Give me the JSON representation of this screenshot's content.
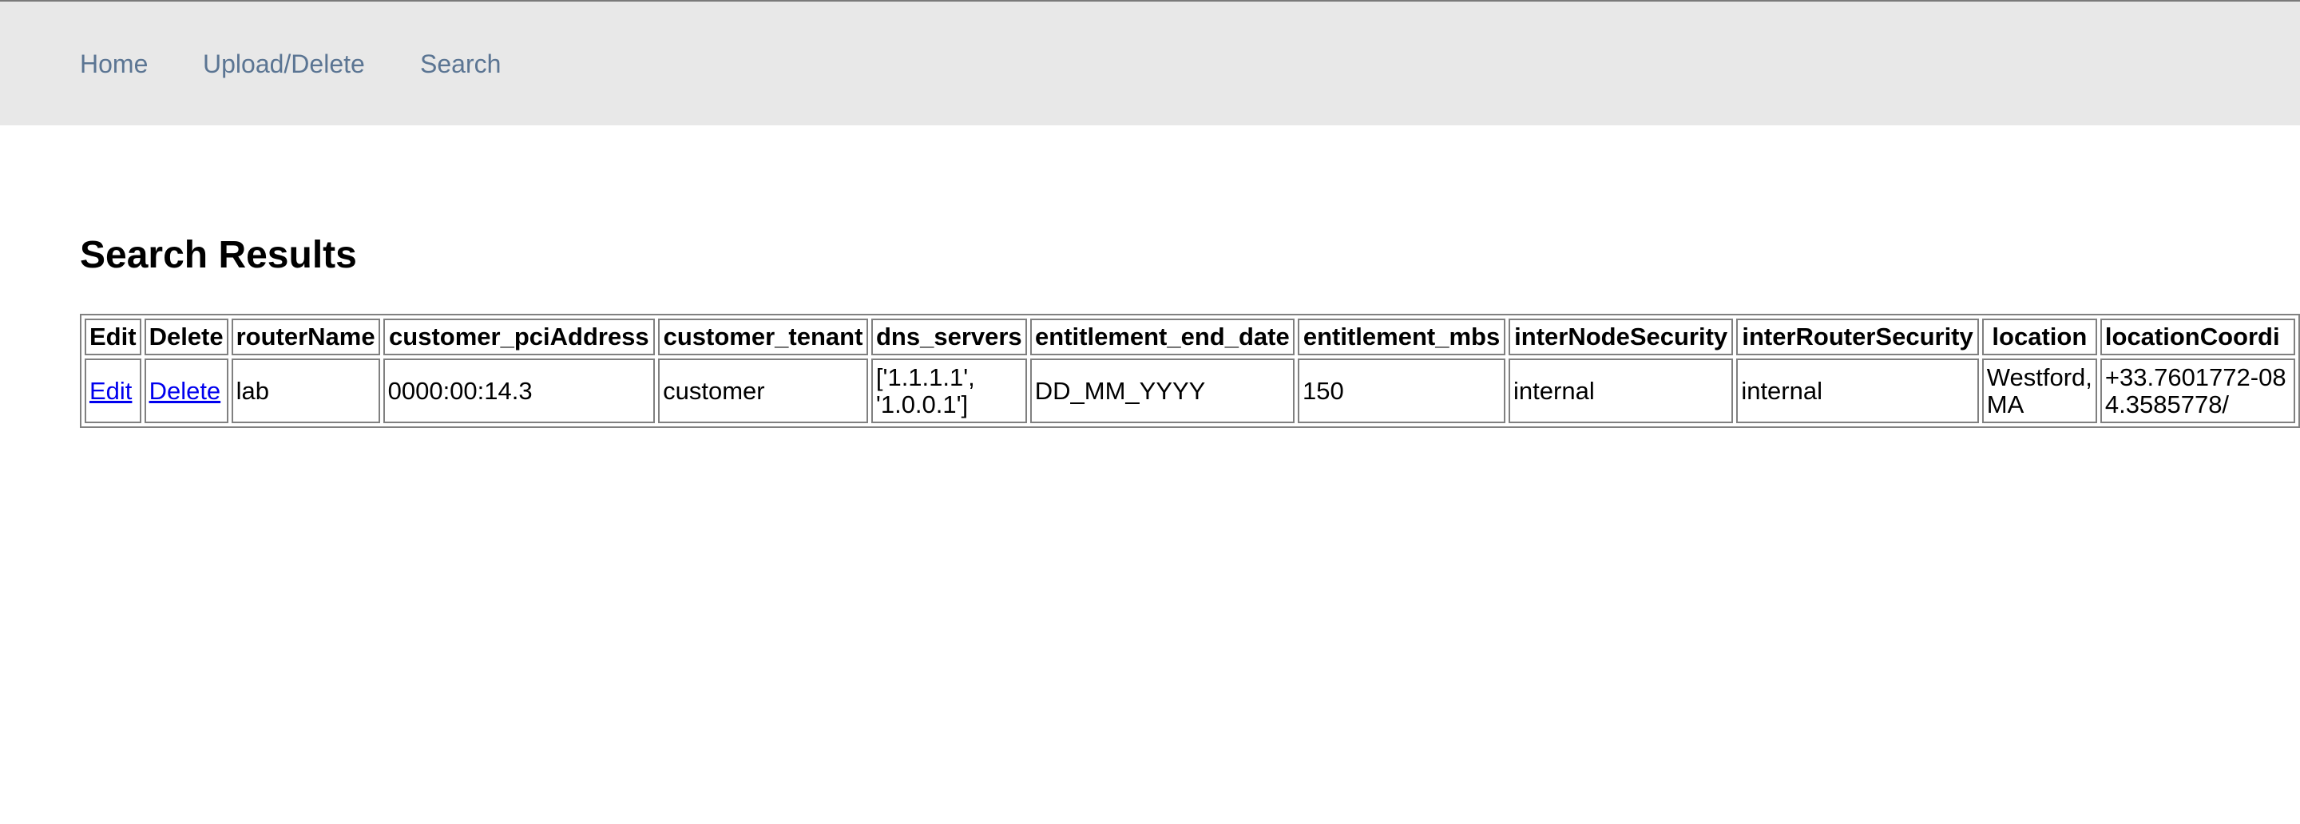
{
  "nav": {
    "home": "Home",
    "upload_delete": "Upload/Delete",
    "search": "Search"
  },
  "page": {
    "title": "Search Results"
  },
  "table": {
    "headers": [
      "Edit",
      "Delete",
      "routerName",
      "customer_pciAddress",
      "customer_tenant",
      "dns_servers",
      "entitlement_end_date",
      "entitlement_mbs",
      "interNodeSecurity",
      "interRouterSecurity",
      "location",
      "locationCoordi"
    ],
    "rows": [
      {
        "edit_link": "Edit",
        "delete_link": "Delete",
        "routerName": "lab",
        "customer_pciAddress": "0000:00:14.3",
        "customer_tenant": "customer",
        "dns_servers": "['1.1.1.1', '1.0.0.1']",
        "entitlement_end_date": "DD_MM_YYYY",
        "entitlement_mbs": "150",
        "interNodeSecurity": "internal",
        "interRouterSecurity": "internal",
        "location": "Westford, MA",
        "locationCoordinates": "+33.7601772-084.3585778/"
      }
    ]
  },
  "colors": {
    "nav_background": "#e8e8e8",
    "nav_link": "#5b7593",
    "link": "#0000ee",
    "border": "#808080"
  }
}
